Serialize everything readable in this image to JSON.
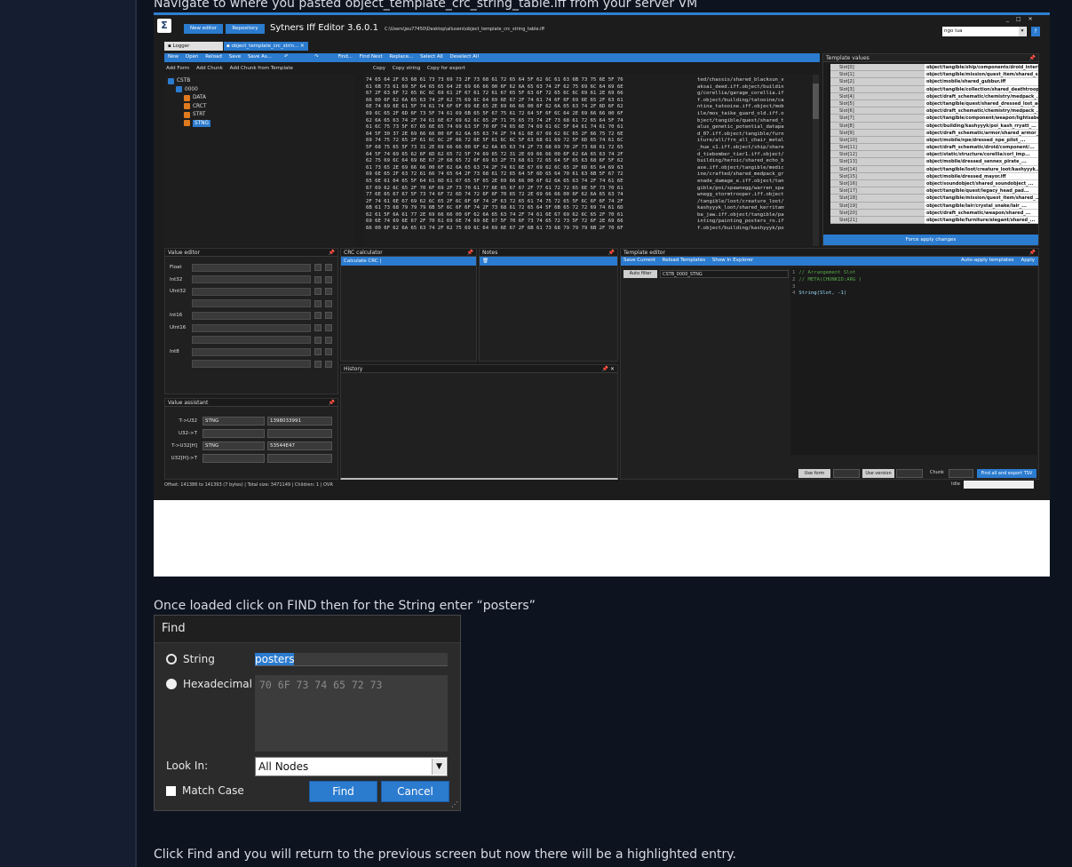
{
  "captions": {
    "top": "Navigate to where you pasted object_template_crc_string_table.iff from your server VM",
    "middle": "Once loaded click on FIND then for the String enter “posters”",
    "bottom": "Click Find and you will return to the previous screen but now there will be a highlighted entry."
  },
  "app": {
    "title": "Sytners Iff Editor 3.6.0.1",
    "path": "C:\\Users\\jeu77450\\Desktop\\allusers\\object_template_crc_string_table.iff",
    "new_editor": "New editor",
    "repository": "Repository",
    "window_controls": [
      "_",
      "□",
      "✕"
    ],
    "lua_select": "ngo lua",
    "help": "?",
    "tabs": [
      "Logger",
      "object_template_crc_strin..."
    ],
    "tab_close": "✕",
    "toolbar": [
      "New",
      "Open",
      "Reload",
      "Save",
      "Save As..."
    ],
    "toolbar2": [
      "Find...",
      "Find Next",
      "Replace...",
      "Select All",
      "Deselect All"
    ],
    "tree_toolbar": [
      "Add Form",
      "Add Chunk",
      "Add Chunk from Template"
    ],
    "hex_toolbar": [
      "Copy",
      "Copy string",
      "Copy for export"
    ],
    "tree": [
      {
        "label": "CSTB",
        "color": "#2b7bcf",
        "depth": 0
      },
      {
        "label": "0000",
        "color": "#2b7bcf",
        "depth": 1
      },
      {
        "label": "DATA",
        "color": "#e07a1f",
        "depth": 2
      },
      {
        "label": "CRCT",
        "color": "#e07a1f",
        "depth": 2
      },
      {
        "label": "STRT",
        "color": "#e07a1f",
        "depth": 2
      },
      {
        "label": "STNG",
        "color": "#e07a1f",
        "depth": 2
      }
    ],
    "hex_lines": [
      "74 65 64 2F 63 68 61 73 73 69 73 2F 73 68 61 72 65 64 5F 62 6C 61 63 6B 73 75 6E 5F 76",
      "61 6B 73 61 69 5F 64 65 65 64 2E 69 66 66 00 6F 62 6A 65 63 74 2F 62 75 69 6C 64 69 6E",
      "67 2F 63 6F 72 65 6C 6C 69 61 2F 67 61 72 61 67 65 5F 63 6F 72 65 6C 6C 69 61 2E 69 66",
      "66 00 6F 62 6A 65 63 74 2F 62 75 69 6C 64 69 6E 67 2F 74 61 74 6F 6F 69 6E 65 2F 63 61",
      "6E 74 69 6E 61 5F 74 61 74 6F 6F 69 6E 65 2E 69 66 66 00 6F 62 6A 65 63 74 2F 6D 6F 62",
      "69 6C 65 2F 6D 6F 73 5F 74 61 69 6B 65 5F 67 75 61 72 64 5F 6F 6C 64 2E 69 66 66 00 6F",
      "62 6A 65 63 74 2F 74 61 6E 67 69 62 6C 65 2F 71 75 65 73 74 2F 73 68 61 72 65 64 5F 74",
      "61 6C 75 73 5F 67 65 6E 65 74 69 63 5F 70 6F 74 65 6E 74 69 61 6C 5F 64 61 74 61 70 61",
      "64 5F 30 37 2E 69 66 66 00 6F 62 6A 65 63 74 2F 74 61 6E 67 69 62 6C 65 2F 66 75 72 6E",
      "69 74 75 72 65 2F 61 6C 6C 2F 66 72 6E 5F 61 6C 6C 5F 63 68 61 69 72 5F 6D 65 74 61 6C",
      "5F 68 75 65 5F 73 31 2E 69 66 66 00 6F 62 6A 65 63 74 2F 73 68 69 70 2F 73 68 61 72 65",
      "64 5F 74 69 65 62 6F 6D 62 65 72 5F 74 69 65 72 31 2E 69 66 66 00 6F 62 6A 65 63 74 2F",
      "62 75 69 6C 64 69 6E 67 2F 68 65 72 6F 69 63 2F 73 68 61 72 65 64 5F 65 63 68 6F 5F 62",
      "61 73 65 2E 69 66 66 00 6F 62 6A 65 63 74 2F 74 61 6E 67 69 62 6C 65 2F 6D 65 64 69 63",
      "69 6E 65 2F 63 72 61 66 74 65 64 2F 73 68 61 72 65 64 5F 6D 65 64 70 61 63 6B 5F 67 72",
      "65 6E 61 64 65 5F 64 61 6D 61 67 65 5F 65 2E 69 66 66 00 6F 62 6A 65 63 74 2F 74 61 6E",
      "67 69 62 6C 65 2F 70 6F 69 2F 73 70 61 77 6E 65 67 67 2F 77 61 72 72 65 6E 5F 73 70 61",
      "77 6E 65 67 67 5F 73 74 6F 72 6D 74 72 6F 6F 70 65 72 2E 69 66 66 00 6F 62 6A 65 63 74",
      "2F 74 61 6E 67 69 62 6C 65 2F 6C 6F 6F 74 2F 63 72 65 61 74 75 72 65 5F 6C 6F 6F 74 2F",
      "6B 61 73 68 79 79 79 6B 5F 6C 6F 6F 74 2F 73 68 61 72 65 64 5F 6B 65 72 72 69 74 61 6D",
      "62 61 5F 6A 61 77 2E 69 66 66 00 6F 62 6A 65 63 74 2F 74 61 6E 67 69 62 6C 65 2F 70 61",
      "69 6E 74 69 6E 67 2F 70 61 69 6E 74 69 6E 67 5F 70 6F 73 74 65 72 73 5F 72 6F 2E 69 66",
      "66 00 6F 62 6A 65 63 74 2F 62 75 69 6C 64 69 6E 67 2F 6B 61 73 68 79 79 79 6B 2F 70 6F"
    ],
    "ascii_lines": [
      "ted/chassis/shared_blacksun_v",
      "aksai_deed.iff.object/buildin",
      "g/corellia/garage_corellia.if",
      "f.object/building/tatooine/ca",
      "ntina_tatooine.iff.object/mob",
      "ile/mos_taike_guard_old.iff.o",
      "bject/tangible/quest/shared_t",
      "alus_genetic_potential_datapa",
      "d_07.iff.object/tangible/furn",
      "iture/all/frn_all_chair_metal",
      "_hue_s1.iff.object/ship/share",
      "d_tiebomber_tier1.iff.object/",
      "building/heroic/shared_echo_b",
      "ase.iff.object/tangible/medic",
      "ine/crafted/shared_medpack_gr",
      "enade_damage_e.iff.object/tan",
      "gible/poi/spawnegg/warren_spa",
      "wnegg_stormtrooper.iff.object",
      "/tangible/loot/creature_loot/",
      "kashyyyk_loot/shared_kerritam",
      "ba_jaw.iff.object/tangible/pa",
      "inting/painting_posters_ro.if",
      "f.object/building/kashyyyk/po"
    ],
    "template_values": {
      "title": "Template values",
      "pin": "📌",
      "rows": [
        [
          "Slot[0]",
          "object/tangible/ship/components/droid_interface/ddi_..."
        ],
        [
          "Slot[1]",
          "object/tangible/mission/quest_item/shared_sayama..."
        ],
        [
          "Slot[2]",
          "object/mobile/shared_gubbur.iff"
        ],
        [
          "Slot[3]",
          "object/tangible/collection/shared_deathtrooper..."
        ],
        [
          "Slot[4]",
          "object/draft_schematic/chemistry/medpack_..."
        ],
        [
          "Slot[5]",
          "object/tangible/quest/shared_dressed_lost_aqualish..."
        ],
        [
          "Slot[6]",
          "object/draft_schematic/chemistry/medpack_..."
        ],
        [
          "Slot[7]",
          "object/tangible/component/weapon/lightsaber..."
        ],
        [
          "Slot[8]",
          "object/building/kashyyyk/poi_kash_rryatt_..."
        ],
        [
          "Slot[9]",
          "object/draft_schematic/armor/shared_armor_..."
        ],
        [
          "Slot[10]",
          "object/mobile/npe/dressed_npe_pilot_..."
        ],
        [
          "Slot[11]",
          "object/draft_schematic/droid/component/..."
        ],
        [
          "Slot[12]",
          "object/static/structure/corellia/corl_imp..."
        ],
        [
          "Slot[13]",
          "object/mobile/dressed_sennex_pirate_..."
        ],
        [
          "Slot[14]",
          "object/tangible/loot/creature_loot/kashyyyk..."
        ],
        [
          "Slot[15]",
          "object/mobile/dressed_mayor.iff"
        ],
        [
          "Slot[16]",
          "object/soundobject/shared_soundobject_..."
        ],
        [
          "Slot[17]",
          "object/tangible/quest/legacy_head_pad..."
        ],
        [
          "Slot[18]",
          "object/tangible/mission/quest_item/shared_..."
        ],
        [
          "Slot[19]",
          "object/tangible/lair/crystal_snake/lair_..."
        ],
        [
          "Slot[20]",
          "object/draft_schematic/weapon/shared_..."
        ],
        [
          "Slot[21]",
          "object/tangible/furniture/elegant/shared_..."
        ]
      ],
      "force_apply": "Force apply changes"
    },
    "value_editor": {
      "title": "Value editor",
      "pin": "📌",
      "labels": [
        "Float",
        "Int32",
        "UInt32",
        "",
        "Int16",
        "UInt16",
        "",
        "Int8",
        ""
      ]
    },
    "value_assistant": {
      "title": "Value assistant",
      "pin": "📌",
      "rows": [
        {
          "label": "T->U32",
          "a": "STNG",
          "b": "1398033991"
        },
        {
          "label": "U32->T",
          "a": "",
          "b": ""
        },
        {
          "label": "T->U32[H]",
          "a": "STNG",
          "b": "53544E47"
        },
        {
          "label": "U32[H]->T",
          "a": "",
          "b": ""
        }
      ]
    },
    "crc": {
      "title": "CRC calculator",
      "pin": "📌",
      "button": "Calculate CRC"
    },
    "notes": {
      "title": "Notes",
      "pin": "📌",
      "icon": "🗑"
    },
    "history": {
      "title": "History",
      "controls": "📌 ✕"
    },
    "template_editor": {
      "title": "Template editor",
      "pin": "📌",
      "actions": [
        "Save Current",
        "Reload Templates",
        "Show In Explorer"
      ],
      "auto_apply": "Auto-apply templates",
      "apply": "Apply",
      "auto_filter": "Auto filter",
      "filter_value": "CSTB_0000_STNG",
      "code": [
        {
          "n": "1",
          "text": "// Arrangement Slot",
          "cls": "c"
        },
        {
          "n": "2",
          "text": "// META(CHUNKID:ARG )",
          "cls": "c"
        },
        {
          "n": "3",
          "text": "",
          "cls": ""
        },
        {
          "n": "4",
          "text": "String(Slot, -1)",
          "cls": "k"
        }
      ],
      "bottom": {
        "use_form": "Use form",
        "use_version": "Use version",
        "chunk": "Chunk",
        "find_export": "Find all and export TSV"
      }
    },
    "status": {
      "left": "Offset: 141386 to 141393 (7 bytes)  |  Total size: 3471149  |  Children: 1  |  OVR",
      "idle": "Idle"
    }
  },
  "find_dialog": {
    "title": "Find",
    "string_label": "String",
    "string_value": "posters",
    "hex_label": "Hexadecimal",
    "hex_value": "70 6F 73 74 65 72 73",
    "look_in_label": "Look In:",
    "look_in_value": "All Nodes",
    "match_case": "Match Case",
    "find": "Find",
    "cancel": "Cancel"
  },
  "colors": {
    "accent": "#2b7bcf",
    "page": "#0d1420",
    "sidebar": "#141e30"
  }
}
